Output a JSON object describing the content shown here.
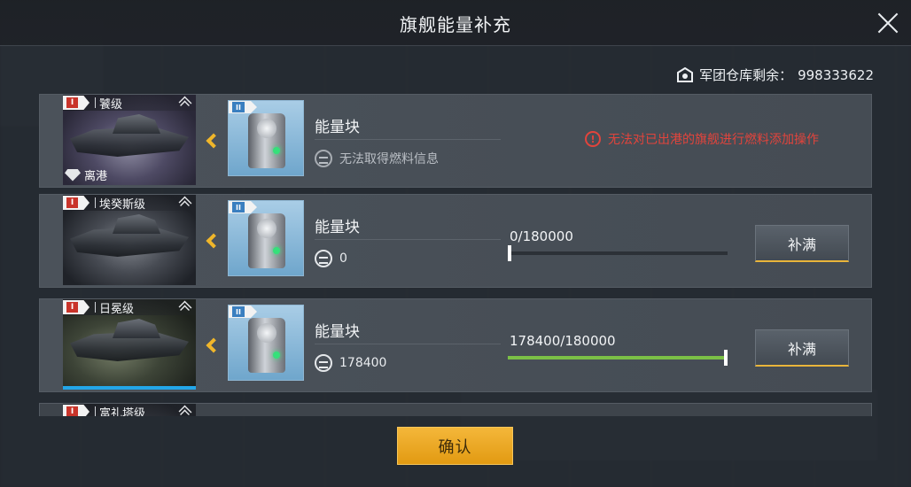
{
  "dialog": {
    "title": "旗舰能量补充",
    "warehouse_label": "军团仓库剩余：",
    "warehouse_value": "998333622",
    "confirm_label": "确认"
  },
  "ships": [
    {
      "tier": "I",
      "name": "饕级",
      "status_tag": "离港",
      "item_tier": "II",
      "item_name": "能量块",
      "fuel_text": "无法取得燃料信息",
      "warning": "无法对已出港的旗舰进行燃料添加操作"
    },
    {
      "tier": "I",
      "name": "埃癸斯级",
      "item_tier": "II",
      "item_name": "能量块",
      "fuel_text": "0",
      "progress_text": "0/180000",
      "progress": 0,
      "fill_label": "补满"
    },
    {
      "tier": "I",
      "name": "日冕级",
      "item_tier": "II",
      "item_name": "能量块",
      "fuel_text": "178400",
      "progress_text": "178400/180000",
      "progress": 0.991,
      "fill_label": "补满",
      "selected": true
    },
    {
      "tier": "I",
      "name": "富礼塔级"
    }
  ],
  "colors": {
    "accent": "#f0b62a",
    "warning": "#e2443c",
    "progress": "#7bc046",
    "selected": "#23a6e8"
  }
}
